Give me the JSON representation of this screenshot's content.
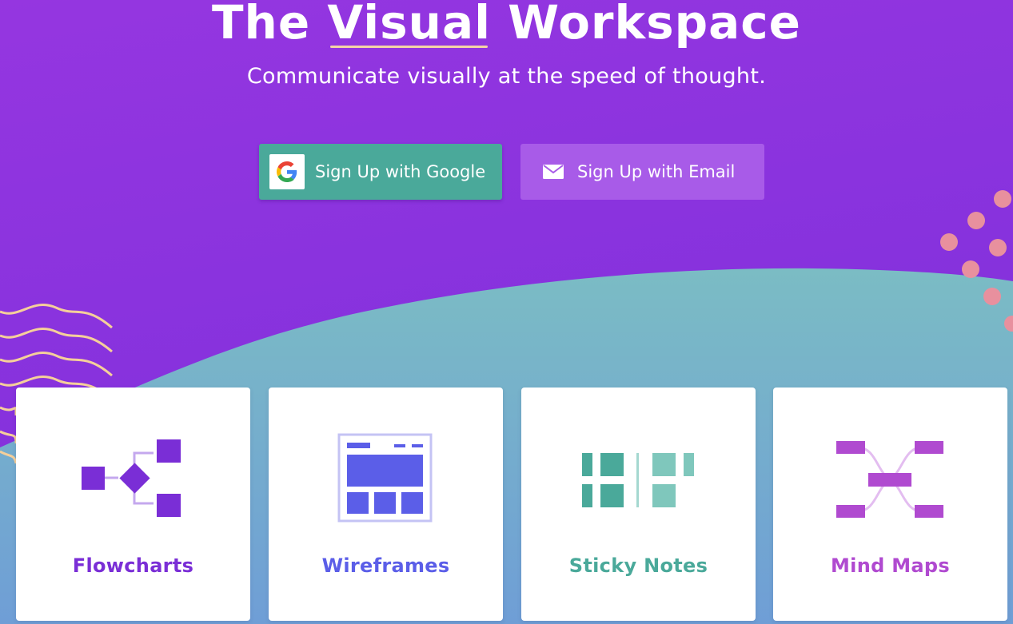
{
  "hero": {
    "title_before": "The ",
    "title_highlight": "Visual",
    "title_after": " Workspace",
    "subtitle": "Communicate visually at the speed of thought."
  },
  "buttons": {
    "google_label": "Sign Up with Google",
    "email_label": "Sign Up with Email"
  },
  "cards": [
    {
      "label": "Flowcharts",
      "icon": "flowchart-icon",
      "color": "#7a2ed6"
    },
    {
      "label": "Wireframes",
      "icon": "wireframe-icon",
      "color": "#5b5ee8"
    },
    {
      "label": "Sticky Notes",
      "icon": "sticky-notes-icon",
      "color": "#4aa99a"
    },
    {
      "label": "Mind Maps",
      "icon": "mind-map-icon",
      "color": "#b04ad0"
    }
  ],
  "colors": {
    "background_purple": "#8a33de",
    "wave_teal": "#7bbcc4",
    "google_button": "#4aa99a",
    "email_button": "#a85be8",
    "accent_peach": "#f5d3a6",
    "dot_pink": "#e8909e"
  }
}
